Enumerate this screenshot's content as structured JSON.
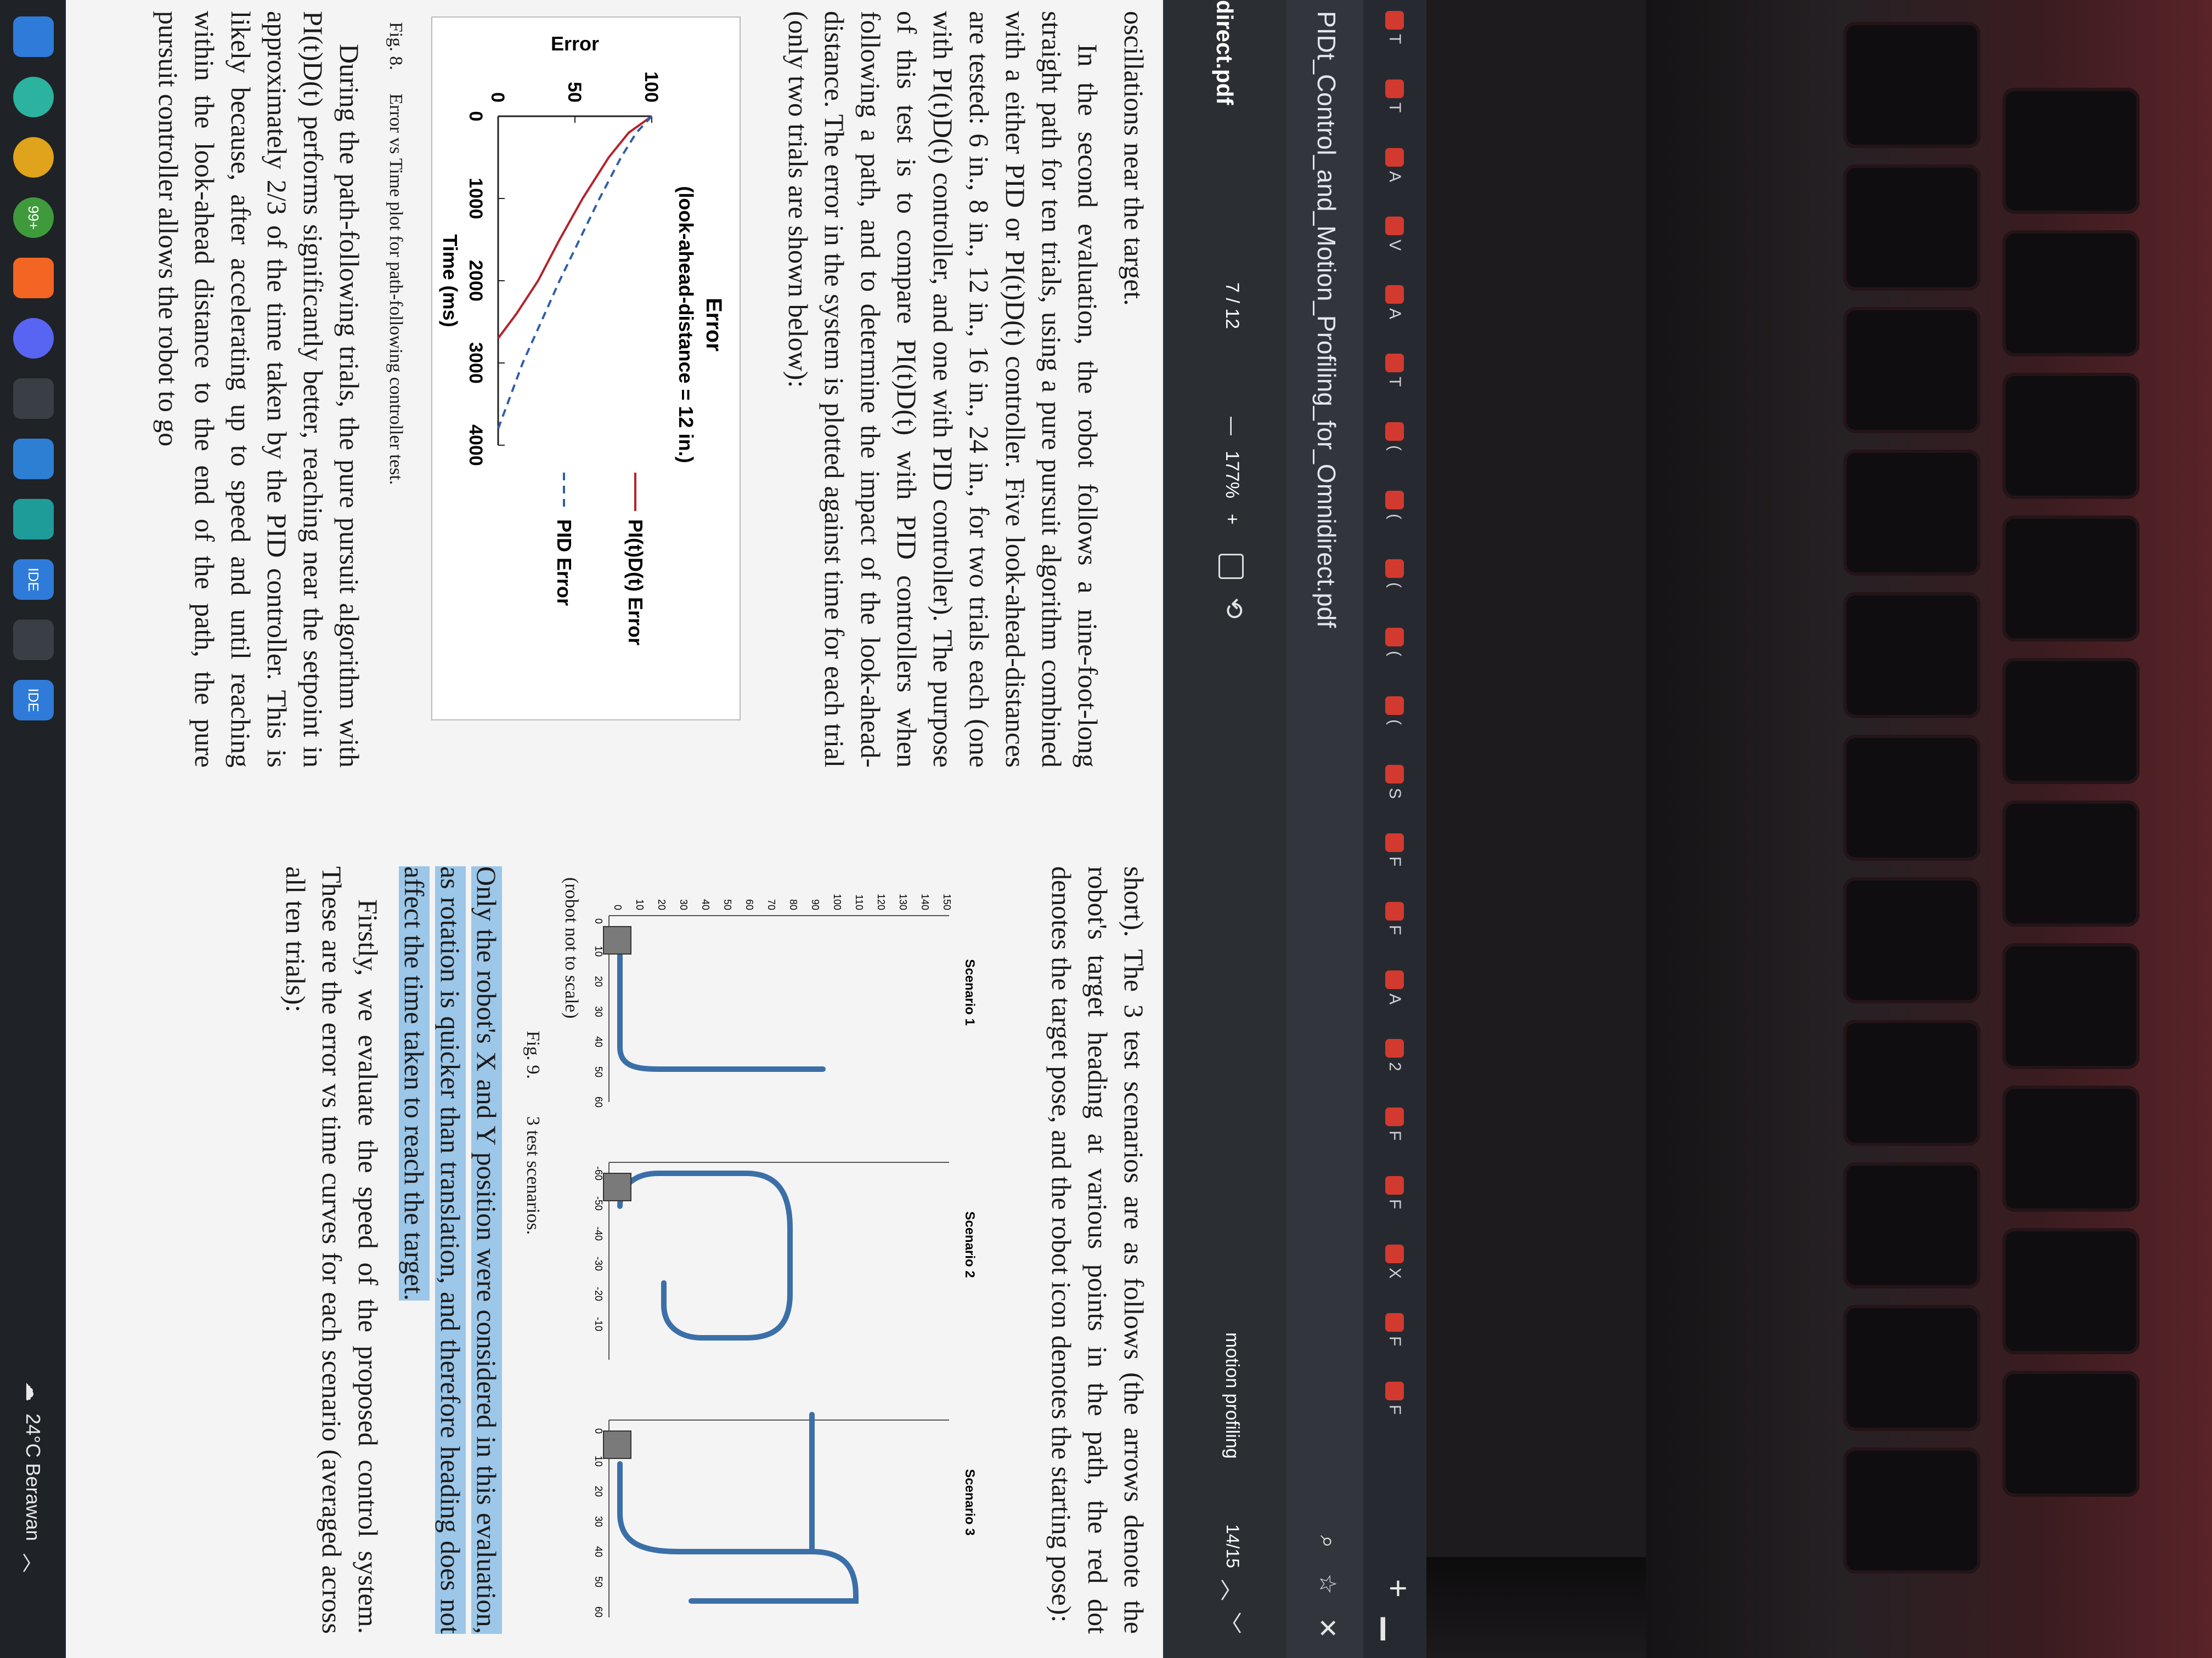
{
  "browser": {
    "tab_marks": [
      "T",
      "T",
      "A",
      "V",
      "A",
      "T",
      "(",
      "(",
      "(",
      "(",
      "(",
      "S",
      "F",
      "F",
      "A",
      "2",
      "F",
      "F",
      "X",
      "F",
      "F"
    ],
    "address": "PIDt_Control_and_Motion_Profiling_for_Omnidirect.pdf",
    "new_tab": "+"
  },
  "pdf": {
    "filename": "direct.pdf",
    "page_current": "7",
    "page_total": "/ 12",
    "zoom": "177%",
    "zoom_out": "—",
    "zoom_in": "+",
    "search_term": "motion profiling",
    "match_count": "14/15"
  },
  "left_column": {
    "line1": "oscillations near the target.",
    "para1": "In the second evaluation, the robot follows a nine-foot-long straight path for ten trials, using a pure pursuit algorithm combined with a either PID or PI(t)D(t) controller. Five look-ahead-distances are tested: 6 in., 8 in., 12 in., 16 in., 24 in., for two trials each (one with PI(t)D(t) controller, and one with PID controller). The purpose of this test is to compare PI(t)D(t) with PID controllers when following a path, and to determine the impact of the look-ahead-distance. The error in the system is plotted against time for each trial (only two trials are shown below):",
    "fig8_label": "Fig. 8.",
    "fig8_caption": "Error vs Time plot for path-following controller test.",
    "para2_a": "During the path-following trials, the pure pursuit algorithm with PI(t)D(t) performs significantly better, reaching near the setpoint in approximately",
    "para2_frac": "2/3",
    "para2_b": "of the time taken by the PID controller. This is likely because, after accelerating up to speed and until reaching within the look-ahead distance to the end of the path, the pure pursuit controller allows the robot to go"
  },
  "right_column": {
    "para1": "short). The 3 test scenarios are as follows (the arrows denote the robot's target heading at various points in the path, the red dot denotes the target pose, and the robot icon denotes the starting pose):",
    "fig9_label": "Fig. 9.",
    "fig9_caption": "3 test scenarios.",
    "para2_highlight": "Only the robot's X and Y position were considered in this evaluation, as rotation is quicker than translation, and therefore heading does not affect the time taken to reach the target.",
    "para3": "Firstly, we evaluate the speed of the proposed control system. These are the error vs time curves for each scenario (averaged across all ten trials):",
    "scenario_titles": [
      "Scenario 1",
      "Scenario 2",
      "Scenario 3"
    ],
    "scale_note": "(robot not to scale)",
    "s1_yticks": [
      "150",
      "140",
      "130",
      "120",
      "110",
      "100",
      "90",
      "80",
      "70",
      "60",
      "50",
      "40",
      "30",
      "20",
      "10",
      "0"
    ],
    "s1_xticks": [
      "0",
      "10",
      "20",
      "30",
      "40",
      "50",
      "60"
    ],
    "s2_xticks": [
      "-60",
      "-50",
      "-40",
      "-30",
      "-20",
      "-10"
    ],
    "s3_xticks": [
      "0",
      "10",
      "20",
      "30",
      "40",
      "50",
      "60"
    ]
  },
  "chart_data": {
    "type": "line",
    "title": "Error",
    "subtitle": "(look-ahead-distance = 12 in.)",
    "xlabel": "Time (ms)",
    "ylabel": "Error",
    "xticks": [
      "0",
      "1000",
      "2000",
      "3000",
      "4000"
    ],
    "yticks": [
      "0",
      "50",
      "100"
    ],
    "xlim": [
      0,
      4000
    ],
    "ylim": [
      0,
      100
    ],
    "series": [
      {
        "name": "PI(t)D(t) Error",
        "style": "solid",
        "color": "#b3232b",
        "x": [
          0,
          200,
          500,
          1000,
          1500,
          2000,
          2400,
          2700
        ],
        "y": [
          100,
          85,
          72,
          55,
          40,
          26,
          12,
          0
        ]
      },
      {
        "name": "PID Error",
        "style": "dashed",
        "color": "#2f5ea8",
        "x": [
          0,
          200,
          500,
          1000,
          1500,
          2000,
          2500,
          3000,
          3500,
          3800
        ],
        "y": [
          100,
          90,
          80,
          66,
          53,
          40,
          28,
          16,
          6,
          0
        ]
      }
    ],
    "legend": "right",
    "grid": false
  },
  "taskbar": {
    "badge": "99+",
    "ide1": "IDE",
    "ide2": "IDE",
    "weather": "24°C Berawan"
  }
}
